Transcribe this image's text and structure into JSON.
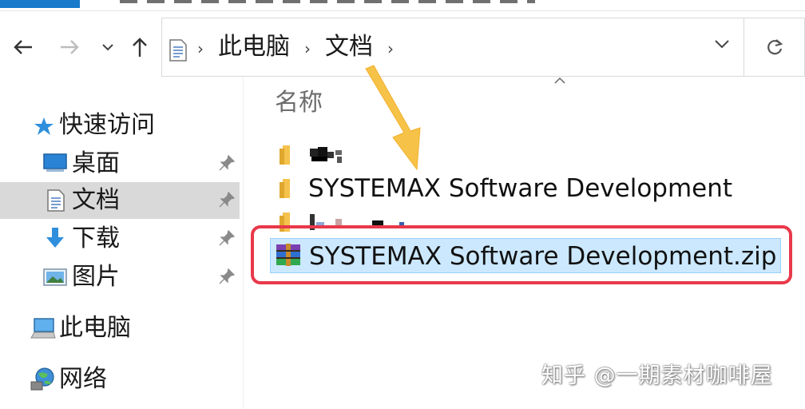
{
  "breadcrumb": [
    "此电脑",
    "文档"
  ],
  "sidebar": {
    "quick_access": "快速访问",
    "items": [
      {
        "label": "桌面",
        "icon": "desktop-icon"
      },
      {
        "label": "文档",
        "icon": "document-icon"
      },
      {
        "label": "下载",
        "icon": "download-icon"
      },
      {
        "label": "图片",
        "icon": "pictures-icon"
      }
    ],
    "this_pc": "此电脑",
    "network": "网络"
  },
  "content": {
    "column_header": "名称",
    "files": [
      {
        "name": "",
        "type": "folder",
        "redacted": true
      },
      {
        "name": "SYSTEMAX Software Development",
        "type": "folder"
      },
      {
        "name": "",
        "type": "folder",
        "redacted": true
      },
      {
        "name": "SYSTEMAX Software Development.zip",
        "type": "zip-archive",
        "selected": true
      }
    ]
  },
  "watermark": "知乎 @一期素材咖啡屋",
  "colors": {
    "selection": "#cce8ff",
    "sidebar_selection": "#d9d9d9",
    "annotation_arrow": "#f7c248",
    "annotation_box": "#e8394a"
  }
}
